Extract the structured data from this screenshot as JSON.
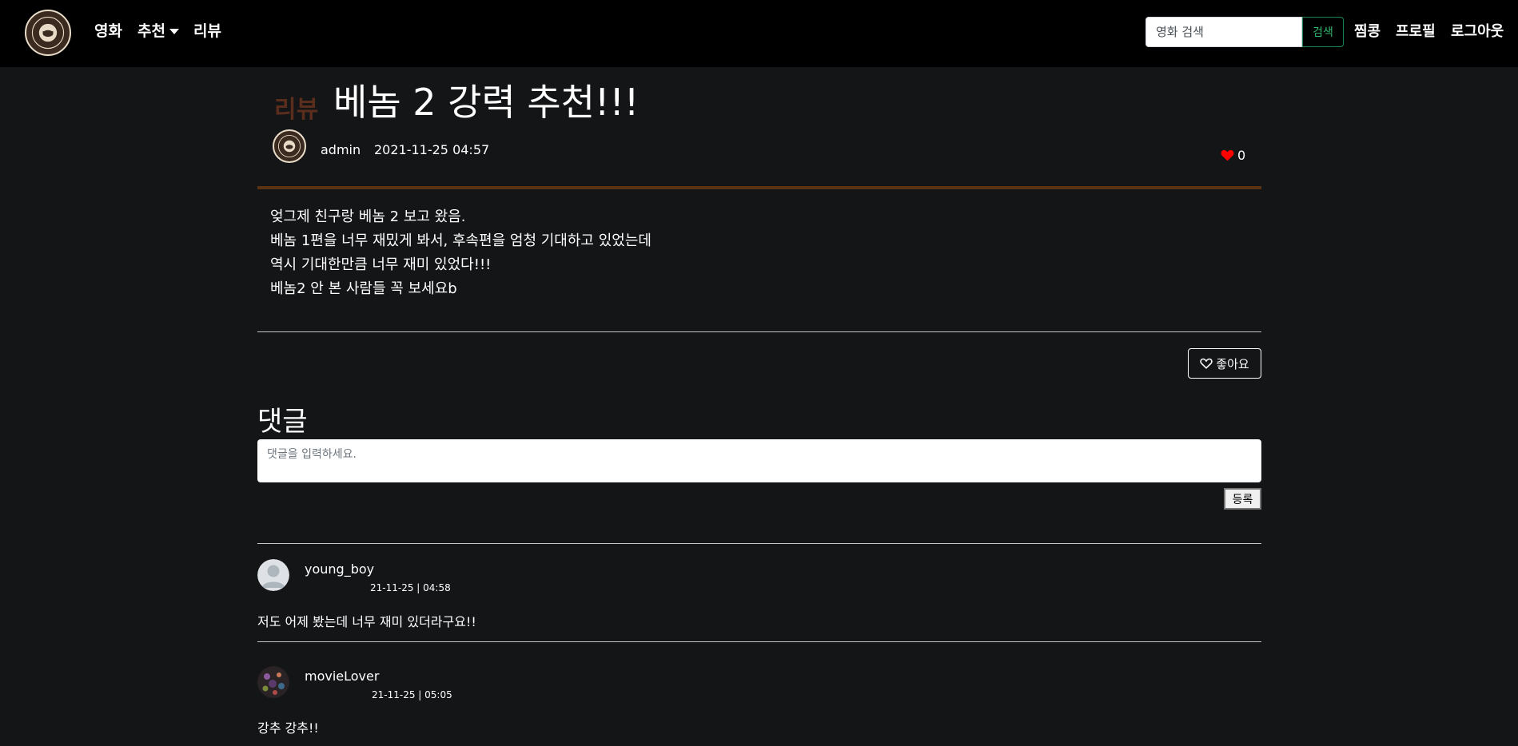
{
  "navbar": {
    "logo_icon": "coffee-logo-icon",
    "menu": [
      {
        "label": "영화"
      },
      {
        "label": "추천"
      },
      {
        "label": "리뷰"
      }
    ],
    "search": {
      "placeholder": "영화 검색",
      "value": "",
      "button_label": "검색"
    },
    "right": [
      {
        "label": "찜콩"
      },
      {
        "label": "프로필"
      },
      {
        "label": "로그아웃"
      }
    ]
  },
  "post": {
    "category": "리뷰",
    "title": "베놈 2 강력 추천!!!",
    "author": "admin",
    "date": "2021-11-25 04:57",
    "like_count": "0",
    "body": [
      "엊그제 친구랑 베놈 2 보고 왔음.",
      "베놈 1편을 너무 재밌게 봐서, 후속편을 엄청 기대하고 있었는데",
      "역시 기대한만큼 너무 재미 있었다!!!",
      "베놈2 안 본 사람들 꼭 보세요b"
    ],
    "like_button_label": "좋아요"
  },
  "comments": {
    "title": "댓글",
    "input_placeholder": "댓글을 입력하세요.",
    "submit_label": "등록",
    "items": [
      {
        "user": "young_boy",
        "time": "21-11-25 | 04:58",
        "text": "저도 어제 봤는데 너무 재미 있더라구요!!",
        "avatar_icon": "default-user-avatar-icon"
      },
      {
        "user": "movieLover",
        "time": "21-11-25 | 05:05",
        "text": "강추 강추!!",
        "avatar_icon": "photo-avatar-icon"
      }
    ]
  },
  "colors": {
    "background": "#141517",
    "navbar": "#000000",
    "category_label": "#5a2d1d",
    "divider_brown": "#5a3214",
    "heart": "#ff0000",
    "search_button": "#198754"
  }
}
